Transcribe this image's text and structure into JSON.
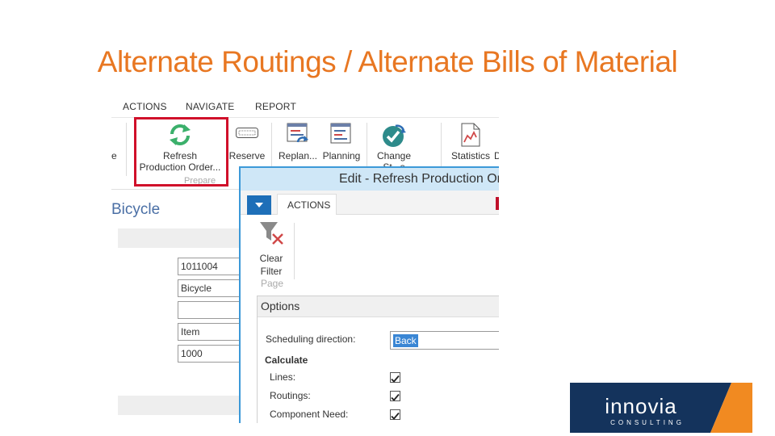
{
  "slide": {
    "title": "Alternate Routings / Alternate Bills of Material"
  },
  "menu": {
    "actions": "ACTIONS",
    "navigate": "NAVIGATE",
    "report": "REPORT"
  },
  "ribbon": {
    "left_fragment": "e",
    "refresh_line1": "Refresh",
    "refresh_line2": "Production Order...",
    "prepare_group": "Prepare",
    "reserve": "Reserve",
    "replan": "Replan...",
    "planning": "Planning",
    "change_status_line1": "Change",
    "change_status_line2": "St...s",
    "statistics": "Statistics",
    "statistics_suffix": "D"
  },
  "card": {
    "title": "Bicycle",
    "fields": [
      "1011004",
      "Bicycle",
      "",
      "Item",
      "1000"
    ]
  },
  "dialog": {
    "title": "Edit - Refresh Production Orde",
    "tab_actions": "ACTIONS",
    "clear_filter_line1": "Clear",
    "clear_filter_line2": "Filter",
    "page_group": "Page",
    "options": {
      "header": "Options",
      "scheduling_direction_label": "Scheduling direction:",
      "scheduling_direction_value": "Back",
      "calculate_heading": "Calculate",
      "lines_label": "Lines:",
      "lines_checked": true,
      "routings_label": "Routings:",
      "routings_checked": true,
      "component_need_label": "Component Need:",
      "component_need_checked": true
    }
  },
  "logo": {
    "brand": "innovia",
    "tagline": "CONSULTING"
  },
  "colors": {
    "title_orange": "#e87722",
    "highlight_red": "#d0102a",
    "dialog_blue": "#3c99d8",
    "logo_navy": "#14335c",
    "logo_orange": "#f18a21"
  }
}
